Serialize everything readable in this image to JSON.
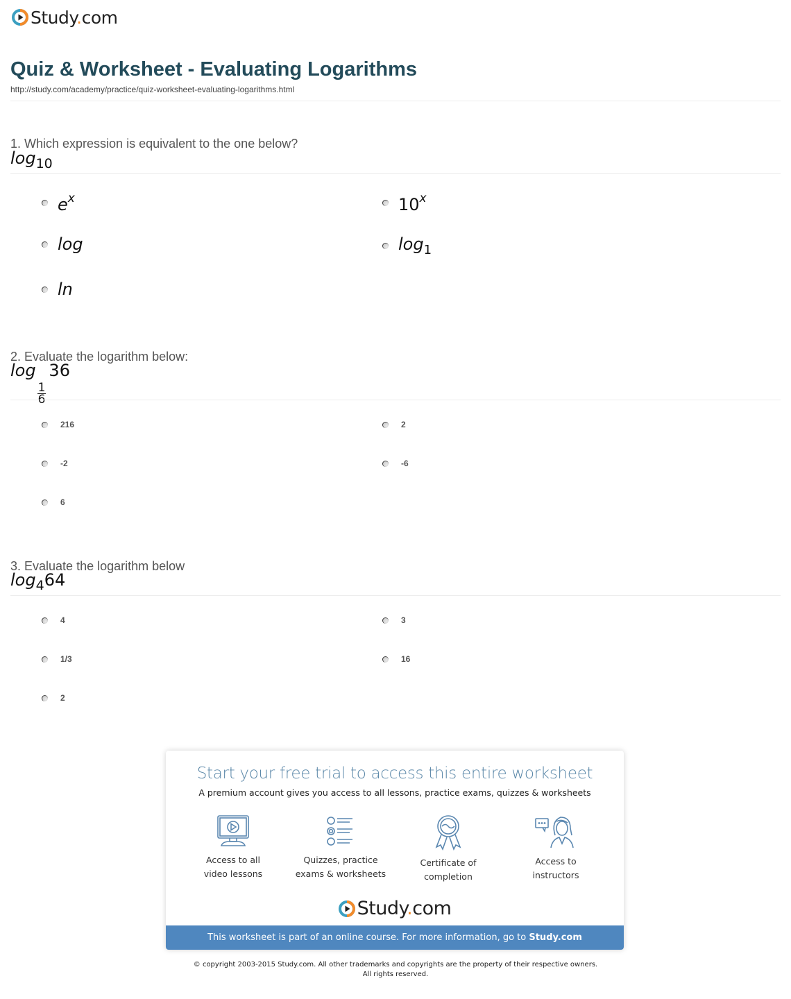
{
  "brand": {
    "name_main": "Study",
    "name_dot": ".",
    "name_tld": "com",
    "accent_orange": "#f28b2b",
    "accent_teal": "#3c9fc0"
  },
  "header": {
    "title": "Quiz & Worksheet - Evaluating Logarithms",
    "url": "http://study.com/academy/practice/quiz-worksheet-evaluating-logarithms.html"
  },
  "questions": [
    {
      "prompt": "1. Which expression is equivalent to the one below?",
      "expression": {
        "fn": "log",
        "base": "10"
      },
      "options": [
        {
          "label": "e",
          "sup": "x"
        },
        {
          "label": "10",
          "sup": "x"
        },
        {
          "label": "log"
        },
        {
          "label": "log",
          "sub": "1"
        },
        {
          "label": "ln"
        }
      ]
    },
    {
      "prompt": "2. Evaluate the logarithm below:",
      "expression": {
        "fn": "log",
        "base_num": "1",
        "base_den": "6",
        "arg": "36"
      },
      "options": [
        "216",
        "2",
        "-2",
        "-6",
        "6"
      ]
    },
    {
      "prompt": "3. Evaluate the logarithm below",
      "expression": {
        "fn": "log",
        "base": "4",
        "arg": "64"
      },
      "options": [
        "4",
        "3",
        "1/3",
        "16",
        "2"
      ]
    }
  ],
  "promo": {
    "title": "Start your free trial to access this entire worksheet",
    "subtitle": "A premium account gives you access to all lessons, practice exams, quizzes & worksheets",
    "features": [
      {
        "icon": "video-lesson-icon",
        "line1": "Access to all",
        "line2": "video lessons"
      },
      {
        "icon": "quiz-list-icon",
        "line1": "Quizzes, practice",
        "line2": "exams & worksheets"
      },
      {
        "icon": "certificate-ribbon-icon",
        "line1": "Certificate of",
        "line2": "completion"
      },
      {
        "icon": "instructor-chat-icon",
        "line1": "Access to",
        "line2": "instructors"
      }
    ],
    "bar_text": "This worksheet is part of an online course. For more information, go to ",
    "bar_link": "Study.com",
    "bar_color": "#4f87bf",
    "title_color": "#5a87a8"
  },
  "footer": {
    "line1": "© copyright 2003-2015 Study.com. All other trademarks and copyrights are the property of their respective owners.",
    "line2": "All rights reserved."
  }
}
